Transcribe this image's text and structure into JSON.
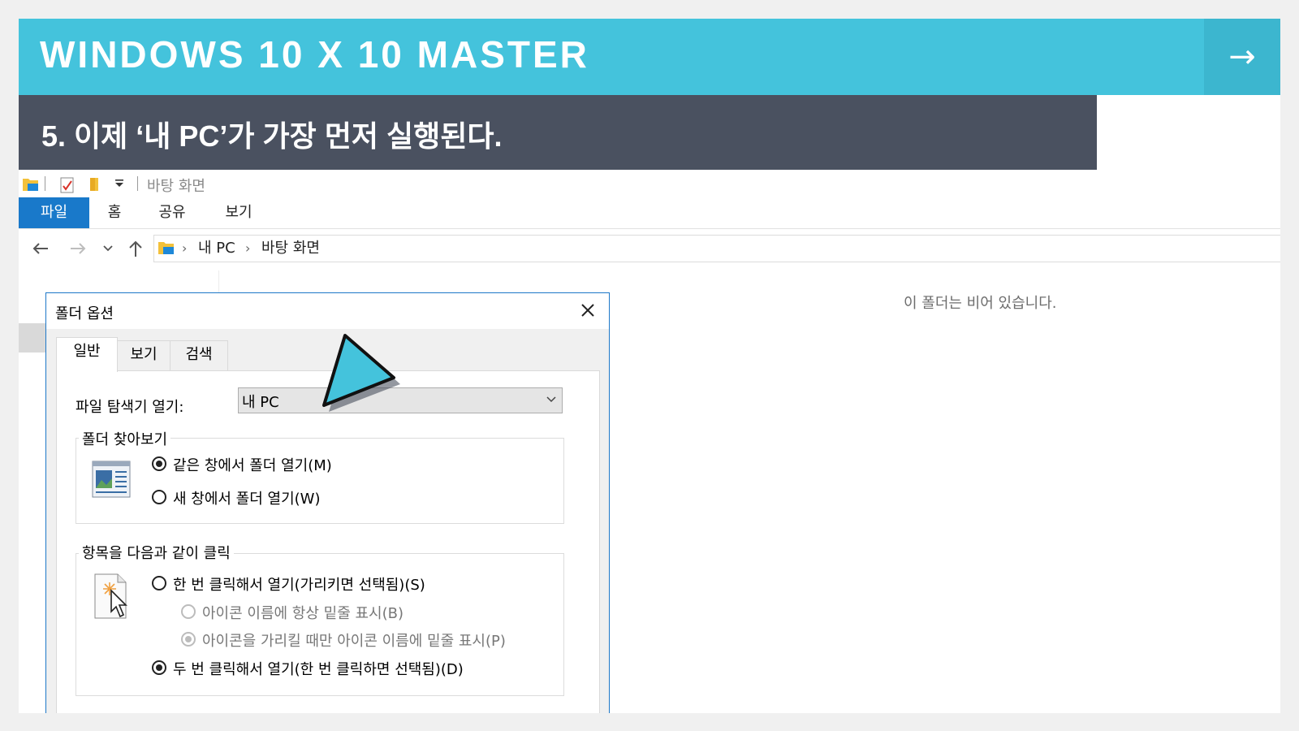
{
  "header": {
    "title": "WINDOWS 10 X 10 MASTER",
    "next_arrow": "→"
  },
  "step": {
    "text": "5. 이제 ‘내 PC’가 가장 먼저 실행된다."
  },
  "explorer": {
    "qat_title": "바탕 화면",
    "ribbon_tabs": [
      "파일",
      "홈",
      "공유",
      "보기"
    ],
    "breadcrumb": [
      "내 PC",
      "바탕 화면"
    ],
    "empty_message": "이 폴더는 비어 있습니다."
  },
  "dialog": {
    "title": "폴더 옵션",
    "tabs": [
      "일반",
      "보기",
      "검색"
    ],
    "open_explorer_label": "파일 탐색기 열기:",
    "open_explorer_value": "내 PC",
    "browse_group": {
      "title": "폴더 찾아보기",
      "options": [
        {
          "label": "같은 창에서 폴더 열기(M)",
          "checked": true
        },
        {
          "label": "새 창에서 폴더 열기(W)",
          "checked": false
        }
      ]
    },
    "click_group": {
      "title": "항목을 다음과 같이 클릭",
      "options": [
        {
          "label": "한 번 클릭해서 열기(가리키면 선택됨)(S)",
          "checked": false,
          "enabled": true
        },
        {
          "label": "아이콘 이름에 항상 밑줄 표시(B)",
          "checked": false,
          "enabled": false
        },
        {
          "label": "아이콘을 가리킬 때만 아이콘 이름에 밑줄 표시(P)",
          "checked": true,
          "enabled": false
        },
        {
          "label": "두 번 클릭해서 열기(한 번 클릭하면 선택됨)(D)",
          "checked": true,
          "enabled": true
        }
      ]
    }
  },
  "colors": {
    "header_bg": "#44c3dc",
    "step_bg": "#4a5160",
    "file_tab": "#1979ca",
    "pointer": "#44c3dc"
  }
}
